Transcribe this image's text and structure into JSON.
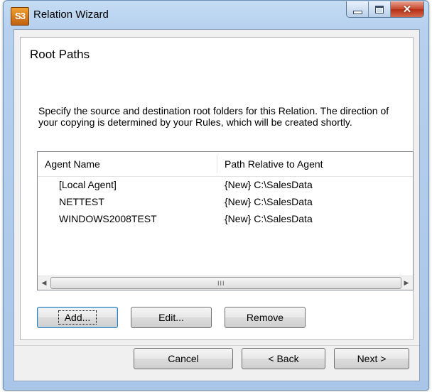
{
  "window": {
    "title": "Relation Wizard",
    "app_icon_text": "S3",
    "caption": {
      "minimize": "minimize",
      "maximize": "maximize",
      "close_glyph": "✕"
    }
  },
  "page": {
    "title": "Root Paths",
    "description": "Specify the source and destination root folders for this Relation. The direction of your copying is determined by your Rules, which will be created shortly."
  },
  "listview": {
    "columns": [
      "Agent Name",
      "Path Relative to Agent"
    ],
    "rows": [
      {
        "agent": "[Local Agent]",
        "path": "{New} C:\\SalesData"
      },
      {
        "agent": "NETTEST",
        "path": "{New} C:\\SalesData"
      },
      {
        "agent": "WINDOWS2008TEST",
        "path": "{New} C:\\SalesData"
      }
    ],
    "scrollbar": {
      "left": "◀",
      "right": "▶",
      "grip": "III"
    }
  },
  "actions": {
    "add": "Add...",
    "edit": "Edit...",
    "remove": "Remove"
  },
  "footer": {
    "cancel": "Cancel",
    "back": "< Back",
    "next": "Next >"
  },
  "colors": {
    "title_bar": "#b6d0ee",
    "close_button": "#c8452c",
    "default_button_border": "#3c7fb1"
  }
}
